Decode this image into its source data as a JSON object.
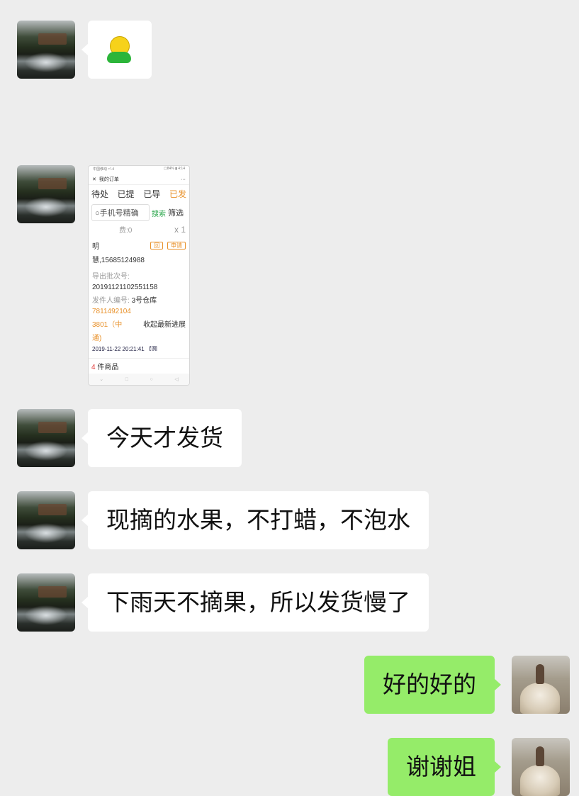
{
  "messages": [
    {
      "side": "left",
      "type": "sticker",
      "icon": "smiley-doll-sticker"
    },
    {
      "side": "left",
      "type": "image",
      "icon": "order-screenshot"
    },
    {
      "side": "left",
      "type": "text",
      "text": "今天才发货"
    },
    {
      "side": "left",
      "type": "text",
      "text": "现摘的水果，不打蜡，不泡水"
    },
    {
      "side": "left",
      "type": "text",
      "text": "下雨天不摘果，所以发货慢了"
    },
    {
      "side": "right",
      "type": "text",
      "text": "好的好的"
    },
    {
      "side": "right",
      "type": "text",
      "text": "谢谢姐"
    }
  ],
  "colors": {
    "bg": "#ededed",
    "incoming": "#ffffff",
    "outgoing": "#95ec69"
  },
  "screenshot": {
    "status_left": "中国移动 ⁴ᴳ.ıl",
    "status_right": "▢84% ▮ 4:14",
    "close": "✕",
    "title": "我的订单",
    "more": "···",
    "tabs": [
      "待处",
      "已提",
      "已导",
      "已发"
    ],
    "search_placeholder": "手机号精确",
    "search_button": "搜索",
    "filter": "筛选",
    "fee": "费:0",
    "qty": "x 1",
    "name_line1": "明",
    "action1": "回",
    "action2": "申请",
    "name_line2": "慧,15685124988",
    "batch_label": "导出批次号:",
    "batch_no": "20191121102551158",
    "sender_label": "发件人编号:",
    "sender_value": "3号仓库",
    "tracking1": "7811492104",
    "tracking2": "3801（中",
    "tracking3": "通)",
    "progress": "收起最新进展",
    "date_partial": "2019-11-22 20:21:41 【圆",
    "count": "4",
    "count_label": "件商品"
  }
}
